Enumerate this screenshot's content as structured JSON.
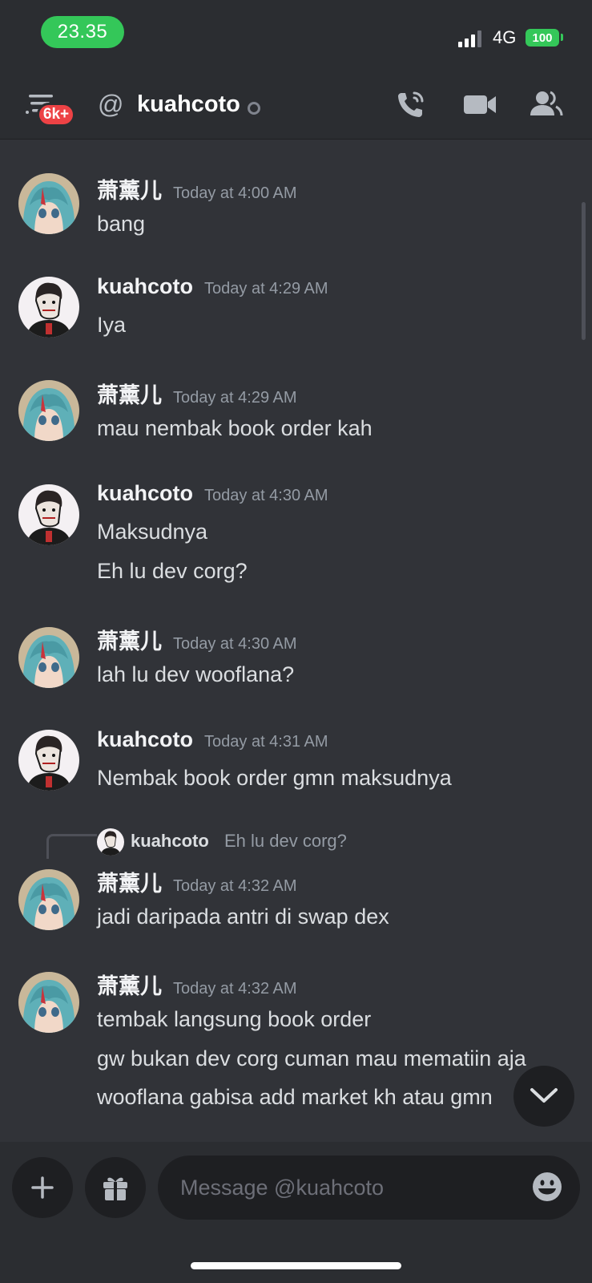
{
  "status_bar": {
    "time": "23.35",
    "network": "4G",
    "battery": "100"
  },
  "header": {
    "notification_badge": "6k+",
    "at_symbol": "@",
    "title": "kuahcoto",
    "icons": [
      "menu-icon",
      "phone-icon",
      "video-camera-icon",
      "members-icon"
    ]
  },
  "messages": [
    {
      "author": "萧薰儿",
      "timestamp": "Today at 4:00 AM",
      "lines": [
        "bang"
      ],
      "avatar": "anime-girl-avatar"
    },
    {
      "author": "kuahcoto",
      "timestamp": "Today at 4:29 AM",
      "lines": [
        "Iya"
      ],
      "avatar": "sketch-man-avatar"
    },
    {
      "author": "萧薰儿",
      "timestamp": "Today at 4:29 AM",
      "lines": [
        "mau nembak book order kah"
      ],
      "avatar": "anime-girl-avatar"
    },
    {
      "author": "kuahcoto",
      "timestamp": "Today at 4:30 AM",
      "lines": [
        "Maksudnya",
        "Eh lu dev corg?"
      ],
      "avatar": "sketch-man-avatar"
    },
    {
      "author": "萧薰儿",
      "timestamp": "Today at 4:30 AM",
      "lines": [
        "lah lu dev wooflana?"
      ],
      "avatar": "anime-girl-avatar"
    },
    {
      "author": "kuahcoto",
      "timestamp": "Today at 4:31 AM",
      "lines": [
        "Nembak book order gmn maksudnya"
      ],
      "avatar": "sketch-man-avatar"
    },
    {
      "author": "萧薰儿",
      "timestamp": "Today at 4:32 AM",
      "lines": [
        "jadi daripada antri di swap dex"
      ],
      "avatar": "anime-girl-avatar",
      "reply_to": {
        "author": "kuahcoto",
        "text": "Eh lu dev corg?"
      }
    },
    {
      "author": "萧薰儿",
      "timestamp": "Today at 4:32 AM",
      "lines": [
        "tembak langsung book order",
        "gw bukan dev corg cuman mau mematiin aja",
        "wooflana gabisa add market kh atau gmn"
      ],
      "avatar": "anime-girl-avatar"
    }
  ],
  "composer": {
    "placeholder": "Message @kuahcoto",
    "icons": [
      "plus-icon",
      "gift-icon",
      "emoji-icon"
    ]
  },
  "jump_button_icon": "chevron-down-icon",
  "colors": {
    "background": "#313338",
    "header_bg": "#2b2d31",
    "input_bg": "#1e1f22",
    "badge_red": "#ed4245",
    "status_green": "#34c759",
    "timestamp_gray": "#949ba4"
  }
}
